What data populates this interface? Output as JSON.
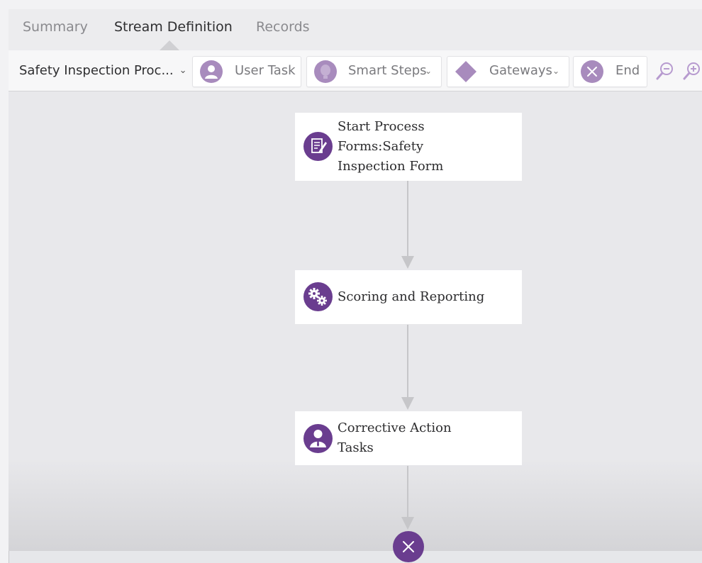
{
  "tabs": [
    {
      "label": "Summary",
      "active": false
    },
    {
      "label": "Stream Definition",
      "active": true
    },
    {
      "label": "Records",
      "active": false
    }
  ],
  "toolbar": {
    "process_select": "Safety Inspection Proc...",
    "user_task": "User Task",
    "smart_steps": "Smart Steps",
    "gateways": "Gateways",
    "end": "End"
  },
  "flow": {
    "start_node": {
      "label_line1": "Start Process",
      "label_line2": "Forms:Safety",
      "label_line3": "Inspection Form",
      "icon": "form-edit-icon"
    },
    "scoring_node": {
      "label": "Scoring and Reporting",
      "icon": "gears-icon"
    },
    "corrective_node": {
      "label_line1": "Corrective Action",
      "label_line2": "Tasks",
      "icon": "user-task-icon"
    },
    "end_node": {
      "icon": "end-x-icon"
    }
  },
  "colors": {
    "accent_purple": "#6a3d8f",
    "light_purple": "#a88bbd",
    "connector": "#c6c6c9"
  }
}
